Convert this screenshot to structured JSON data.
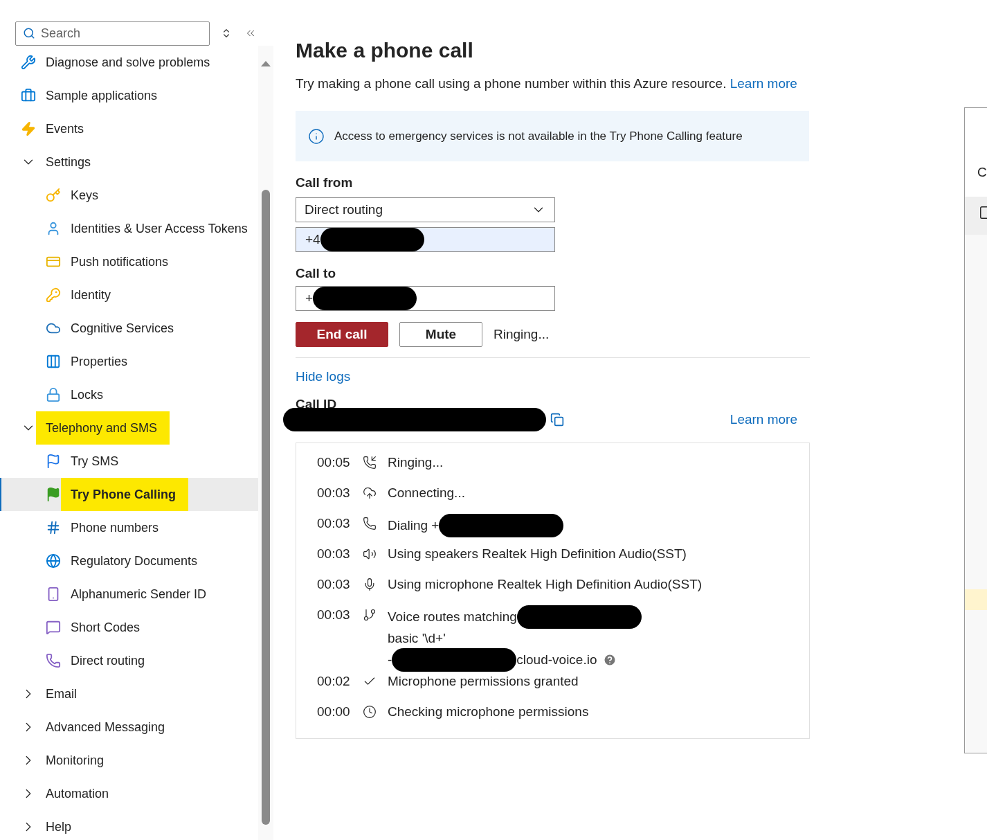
{
  "sidebar": {
    "search": {
      "placeholder": "Search"
    },
    "items": [
      {
        "label": "Diagnose and solve problems",
        "selected": false,
        "highlighted": false
      },
      {
        "label": "Sample applications",
        "selected": false,
        "highlighted": false
      },
      {
        "label": "Events",
        "selected": false,
        "highlighted": false
      },
      {
        "label": "Settings",
        "selected": false,
        "highlighted": false,
        "expanded": true,
        "children": [
          {
            "label": "Keys",
            "selected": false,
            "highlighted": false
          },
          {
            "label": "Identities & User Access Tokens",
            "selected": false,
            "highlighted": false
          },
          {
            "label": "Push notifications",
            "selected": false,
            "highlighted": false
          },
          {
            "label": "Identity",
            "selected": false,
            "highlighted": false
          },
          {
            "label": "Cognitive Services",
            "selected": false,
            "highlighted": false
          },
          {
            "label": "Properties",
            "selected": false,
            "highlighted": false
          },
          {
            "label": "Locks",
            "selected": false,
            "highlighted": false
          }
        ]
      },
      {
        "label": "Telephony and SMS",
        "selected": false,
        "highlighted": true,
        "expanded": true,
        "children": [
          {
            "label": "Try SMS",
            "selected": false,
            "highlighted": false
          },
          {
            "label": "Try Phone Calling",
            "selected": true,
            "highlighted": true
          },
          {
            "label": "Phone numbers",
            "selected": false,
            "highlighted": false
          },
          {
            "label": "Regulatory Documents",
            "selected": false,
            "highlighted": false
          },
          {
            "label": "Alphanumeric Sender ID",
            "selected": false,
            "highlighted": false
          },
          {
            "label": "Short Codes",
            "selected": false,
            "highlighted": false
          },
          {
            "label": "Direct routing",
            "selected": false,
            "highlighted": false
          }
        ]
      },
      {
        "label": "Email",
        "selected": false,
        "highlighted": false,
        "expanded": false
      },
      {
        "label": "Advanced Messaging",
        "selected": false,
        "highlighted": false,
        "expanded": false
      },
      {
        "label": "Monitoring",
        "selected": false,
        "highlighted": false,
        "expanded": false
      },
      {
        "label": "Automation",
        "selected": false,
        "highlighted": false,
        "expanded": false
      },
      {
        "label": "Help",
        "selected": false,
        "highlighted": false,
        "expanded": false
      }
    ]
  },
  "main": {
    "title": "Make a phone call",
    "description": "Try making a phone call using a phone number within this Azure resource.",
    "description_link": "Learn more",
    "info": "Access to emergency services is not available in the Try Phone Calling feature",
    "call_from": {
      "label": "Call from",
      "dropdown": "Direct routing",
      "number": "+4"
    },
    "call_to": {
      "label": "Call to",
      "number": "+"
    },
    "buttons": [
      {
        "label": "End call",
        "kind": "danger"
      },
      {
        "label": "Mute",
        "kind": "default"
      }
    ],
    "status": "Ringing...",
    "logs_link": "Hide logs",
    "call_id_label": "Call ID",
    "learn_more": "Learn more",
    "logs": [
      {
        "time": "00:05",
        "segments": [
          {
            "kind": "text",
            "text": "Ringing..."
          }
        ]
      },
      {
        "time": "00:03",
        "segments": [
          {
            "kind": "text",
            "text": "Connecting..."
          }
        ]
      },
      {
        "time": "00:03",
        "segments": [
          {
            "kind": "text",
            "text": "Dialing +"
          },
          {
            "kind": "redacted"
          }
        ]
      },
      {
        "time": "00:03",
        "segments": [
          {
            "kind": "text",
            "text": "Using speakers Realtek High Definition Audio(SST)"
          }
        ]
      },
      {
        "time": "00:03",
        "segments": [
          {
            "kind": "text",
            "text": "Using microphone Realtek High Definition Audio(SST)"
          }
        ]
      },
      {
        "time": "00:03",
        "segments": [
          {
            "kind": "text",
            "text": "Voice routes matching"
          },
          {
            "kind": "redacted"
          },
          {
            "kind": "newline"
          },
          {
            "kind": "text",
            "text": "basic '\\d+'"
          },
          {
            "kind": "newline"
          },
          {
            "kind": "text",
            "text": "-"
          },
          {
            "kind": "redacted"
          },
          {
            "kind": "text",
            "text": "cloud-voice.io"
          },
          {
            "kind": "help"
          }
        ]
      },
      {
        "time": "00:02",
        "segments": [
          {
            "kind": "text",
            "text": "Microphone permissions granted"
          }
        ]
      },
      {
        "time": "00:00",
        "segments": [
          {
            "kind": "text",
            "text": "Checking microphone permissions"
          }
        ]
      }
    ]
  },
  "side_panel": {
    "heading": "C"
  }
}
